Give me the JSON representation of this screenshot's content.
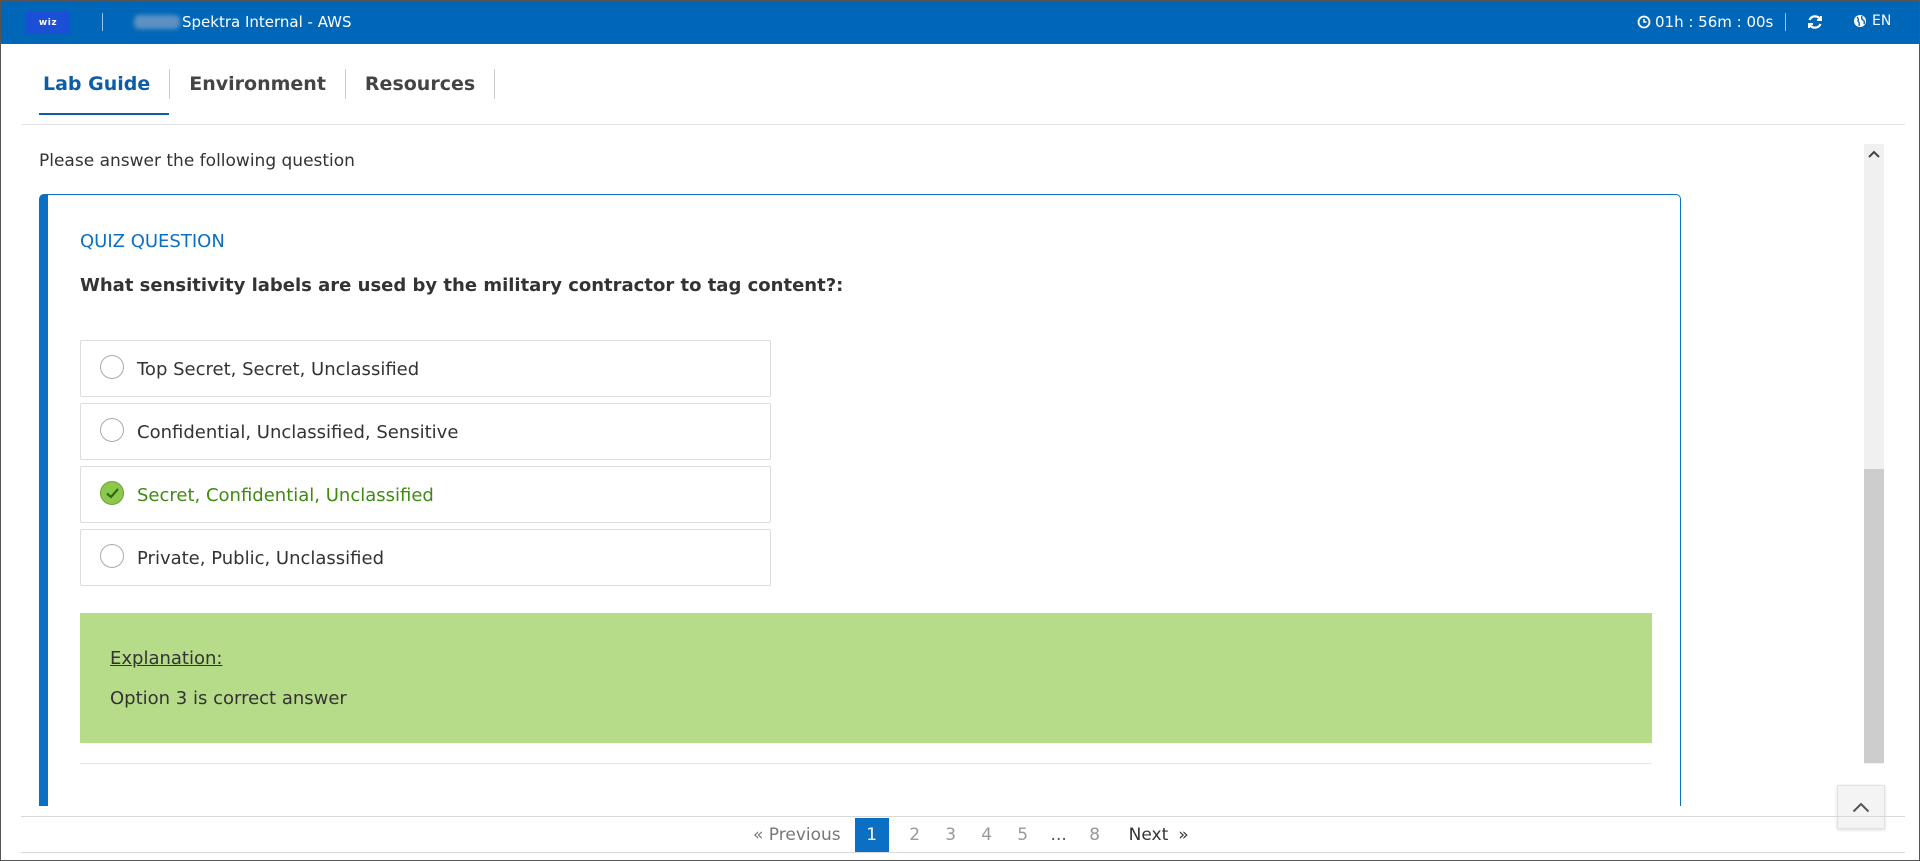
{
  "header": {
    "logo_text": "wiz",
    "app_title": "Spektra Internal - AWS",
    "timer": "01h : 56m : 00s",
    "language": "EN",
    "bar_color": "#0067b8"
  },
  "tabs": [
    {
      "label": "Lab Guide",
      "active": true
    },
    {
      "label": "Environment",
      "active": false
    },
    {
      "label": "Resources",
      "active": false
    }
  ],
  "content": {
    "intro": "Please answer the following question",
    "quiz": {
      "label": "QUIZ QUESTION",
      "question": "What sensitivity labels are used by the military contractor to tag content?:",
      "options": [
        {
          "text": "Top Secret, Secret, Unclassified",
          "selected": false
        },
        {
          "text": "Confidential, Unclassified, Sensitive",
          "selected": false
        },
        {
          "text": "Secret, Confidential, Unclassified",
          "selected": true
        },
        {
          "text": "Private, Public, Unclassified",
          "selected": false
        }
      ],
      "explanation_title": "Explanation:",
      "explanation_text": "Option 3 is correct answer"
    }
  },
  "pagination": {
    "previous": "« Previous",
    "current": "1",
    "pages": [
      "2",
      "3",
      "4",
      "5"
    ],
    "ellipsis": "...",
    "last": "8",
    "next": "Next",
    "next_arrow": "»"
  },
  "colors": {
    "accent": "#0b6fc4",
    "correct_text": "#3f8a12",
    "explanation_bg": "#b6dc8a"
  },
  "icons": [
    "clock-icon",
    "refresh-icon",
    "globe-icon",
    "check-icon",
    "chevron-up-icon"
  ]
}
